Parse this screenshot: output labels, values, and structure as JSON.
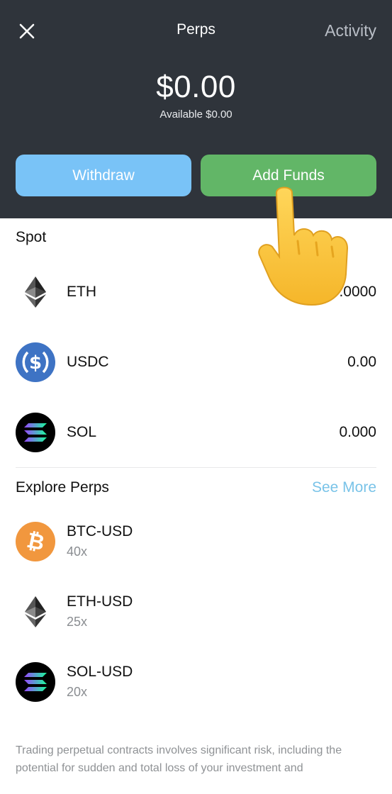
{
  "header": {
    "title": "Perps",
    "activity_label": "Activity",
    "balance": "$0.00",
    "available": "Available $0.00",
    "withdraw_label": "Withdraw",
    "add_funds_label": "Add Funds"
  },
  "spot": {
    "title": "Spot",
    "items": [
      {
        "symbol": "ETH",
        "amount": "0.0000",
        "icon": "eth-icon"
      },
      {
        "symbol": "USDC",
        "amount": "0.00",
        "icon": "usdc-icon"
      },
      {
        "symbol": "SOL",
        "amount": "0.000",
        "icon": "sol-icon"
      }
    ]
  },
  "explore": {
    "title": "Explore Perps",
    "see_more_label": "See More",
    "items": [
      {
        "pair": "BTC-USD",
        "leverage": "40x",
        "icon": "btc-icon"
      },
      {
        "pair": "ETH-USD",
        "leverage": "25x",
        "icon": "eth-icon"
      },
      {
        "pair": "SOL-USD",
        "leverage": "20x",
        "icon": "sol-icon"
      }
    ]
  },
  "disclaimer": "Trading perpetual contracts involves significant risk, including the potential for sudden and total loss of your investment and",
  "colors": {
    "header_bg": "#2f343b",
    "withdraw": "#79c3f7",
    "add_funds": "#62b667",
    "see_more": "#79c3e8"
  }
}
